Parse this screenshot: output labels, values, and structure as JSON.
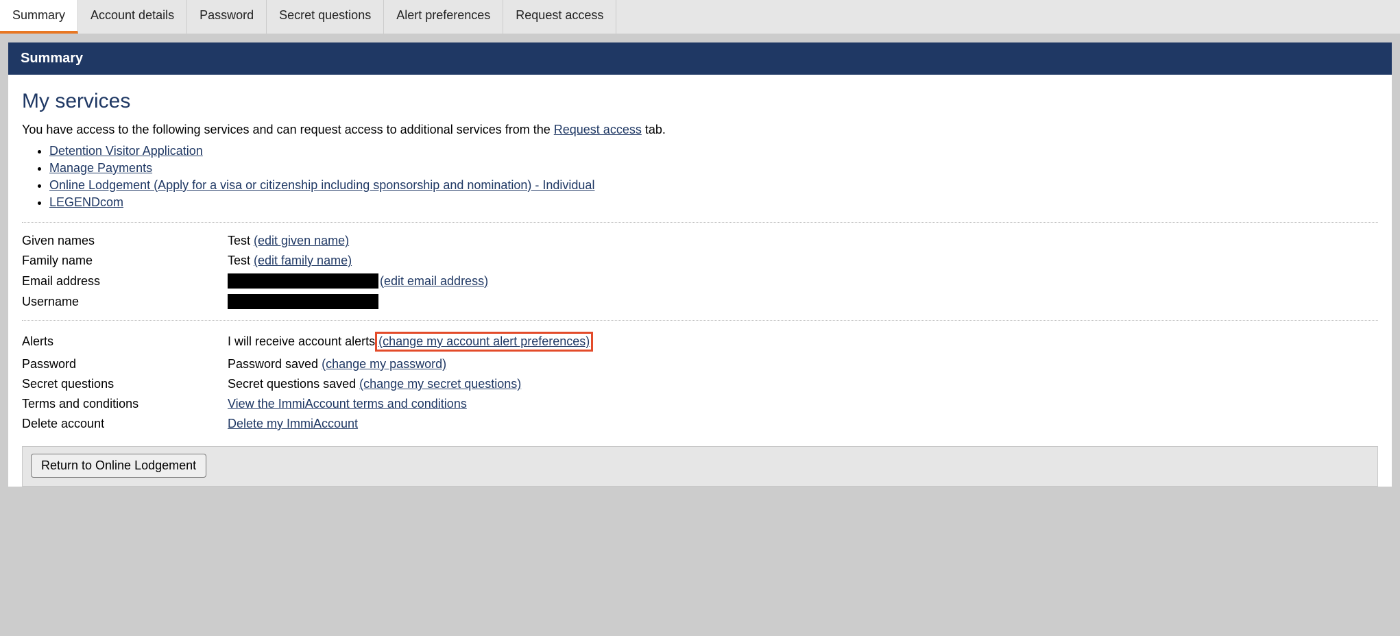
{
  "tabs": [
    {
      "label": "Summary",
      "active": true
    },
    {
      "label": "Account details",
      "active": false
    },
    {
      "label": "Password",
      "active": false
    },
    {
      "label": "Secret questions",
      "active": false
    },
    {
      "label": "Alert preferences",
      "active": false
    },
    {
      "label": "Request access",
      "active": false
    }
  ],
  "banner_title": "Summary",
  "services_heading": "My services",
  "intro_prefix": "You have access to the following services and can request access to additional services from the ",
  "intro_link": "Request access",
  "intro_suffix": " tab.",
  "service_links": [
    "Detention Visitor Application",
    "Manage Payments",
    "Online Lodgement (Apply for a visa or citizenship including sponsorship and nomination) - Individual",
    "LEGENDcom"
  ],
  "fields_personal": {
    "given_names": {
      "label": "Given names",
      "value": "Test",
      "edit": "(edit given name)"
    },
    "family_name": {
      "label": "Family name",
      "value": "Test",
      "edit": "(edit family name)"
    },
    "email": {
      "label": "Email address",
      "edit": "(edit email address)"
    },
    "username": {
      "label": "Username"
    }
  },
  "fields_account": {
    "alerts": {
      "label": "Alerts",
      "value": "I will receive account alerts",
      "edit": "(change my account alert preferences)"
    },
    "password": {
      "label": "Password",
      "value": "Password saved",
      "edit": "(change my password)"
    },
    "secret_questions": {
      "label": "Secret questions",
      "value": "Secret questions saved",
      "edit": "(change my secret questions)"
    },
    "terms": {
      "label": "Terms and conditions",
      "link": "View the ImmiAccount terms and conditions"
    },
    "delete": {
      "label": "Delete account",
      "link": "Delete my ImmiAccount"
    }
  },
  "return_button": "Return to Online Lodgement"
}
